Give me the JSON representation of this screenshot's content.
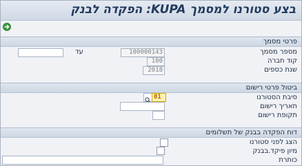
{
  "title": "בצע סטורנו למסמך KUPA: הפקדה לבנק",
  "toolbar": {
    "execute_icon": "execute-icon"
  },
  "doc_details": {
    "header": "פרטי מסמך",
    "doc_number_label": "מספר מסמך",
    "doc_number_value": "100000143",
    "to_label": "עד",
    "to_value": "",
    "company_code_label": "קוד חברה",
    "company_code_value": "100",
    "fiscal_year_label": "שנת כספים",
    "fiscal_year_value": "2018"
  },
  "reversal": {
    "header": "ביטול פרטי רישום",
    "reason_label": "סיבת הסטורנו",
    "reason_value": "01",
    "posting_date_label": "תאריך רישום",
    "posting_date_value": "",
    "posting_period_label": "תקופת רישום",
    "posting_period_value": ""
  },
  "report": {
    "header": "דוח הפקדה בבנק של תשלומים",
    "show_before_label": "הצג לפני סטורנו",
    "show_before_checked": false,
    "sort_label": "מיון פיקד.בבנק",
    "sort_checked": false,
    "heading_label": "כותרת",
    "heading_value": ""
  }
}
